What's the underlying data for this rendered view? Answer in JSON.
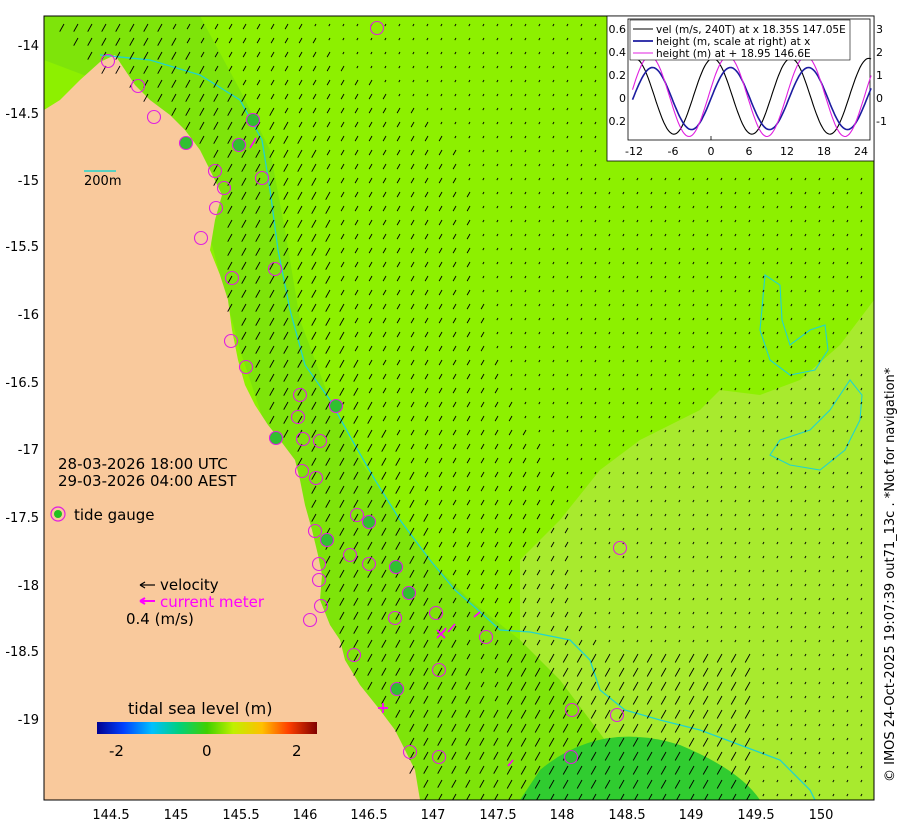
{
  "map": {
    "x_ticks": [
      "144.5",
      "145",
      "145.5",
      "146",
      "146.5",
      "147",
      "147.5",
      "148",
      "148.5",
      "149",
      "149.5",
      "150"
    ],
    "y_ticks": [
      "-14",
      "-14.5",
      "-15",
      "-15.5",
      "-16",
      "-16.5",
      "-17",
      "-17.5",
      "-18",
      "-18.5",
      "-19"
    ],
    "scale_label": "200m",
    "time_utc": "28-03-2026 18:00 UTC",
    "time_aest": "29-03-2026 04:00 AEST",
    "legend": {
      "tide_gauge": "tide gauge",
      "velocity": "velocity",
      "current_meter": "current meter",
      "speed_scale": "0.4 (m/s)"
    },
    "colorbar": {
      "title": "tidal sea level (m)",
      "ticks": [
        "-2",
        "0",
        "2"
      ]
    },
    "credit": "© IMOS 24-Oct-2025 19:07:39 out71_13c . *Not for navigation*",
    "colors": {
      "land": "#f9c99c",
      "sea_offshore": "#8df000",
      "sea_mid": "#78e010",
      "sea_south": "#a8ea2e",
      "contour": "#22d4cc",
      "gauge_ring": "#e020e0",
      "current_meter": "#ff00ff"
    }
  },
  "inset": {
    "legend": [
      "vel (m/s, 240T) at x 18.35S 147.05E",
      "height (m, scale at right) at x",
      "height (m) at + 18.95 146.6E"
    ],
    "left_ticks": [
      "0.6",
      "0.4",
      "0.2",
      "0",
      "0.2"
    ],
    "right_ticks": [
      "3",
      "2",
      "1",
      "0",
      "-1"
    ],
    "x_ticks": [
      "-12",
      "-6",
      "0",
      "6",
      "12",
      "18",
      "24"
    ]
  }
}
